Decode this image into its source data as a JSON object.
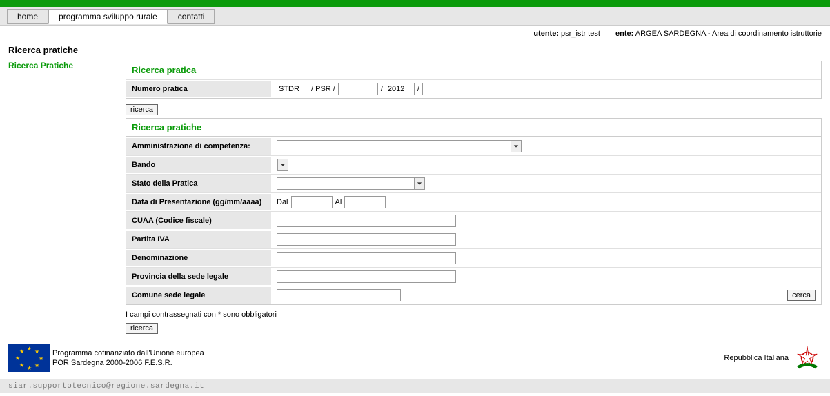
{
  "nav": {
    "home": "home",
    "psr": "programma sviluppo rurale",
    "contatti": "contatti"
  },
  "user": {
    "utente_label": "utente:",
    "utente_value": "psr_istr test",
    "ente_label": "ente:",
    "ente_value": "ARGEA SARDEGNA - Area di coordinamento istruttorie"
  },
  "page_title": "Ricerca pratiche",
  "sidebar": {
    "ricerca_pratiche": "Ricerca Pratiche"
  },
  "panel1": {
    "title": "Ricerca pratica",
    "numero_label": "Numero pratica",
    "seg0": "STDR",
    "sep1": "/ PSR /",
    "seg2": "",
    "sep2": "/",
    "seg3": "2012",
    "sep3": "/",
    "seg4": ""
  },
  "btn_ricerca": "ricerca",
  "panel2": {
    "title": "Ricerca pratiche",
    "amministrazione": "Amministrazione di competenza:",
    "bando": "Bando",
    "stato": "Stato della Pratica",
    "data_pres": "Data di Presentazione (gg/mm/aaaa)",
    "dal": "Dal",
    "al": "Al",
    "cuaa": "CUAA (Codice fiscale)",
    "piva": "Partita IVA",
    "denominazione": "Denominazione",
    "provincia": "Provincia della sede legale",
    "comune": "Comune sede legale",
    "cerca": "cerca"
  },
  "note": "I campi contrassegnati con * sono obbligatori",
  "btn_ricerca2": "ricerca",
  "footer": {
    "line1": "Programma cofinanziato dall'Unione europea",
    "line2": "POR Sardegna 2000-2006 F.E.S.R.",
    "rep": "Repubblica Italiana"
  },
  "contact_email": "siar.supportotecnico@regione.sardegna.it"
}
